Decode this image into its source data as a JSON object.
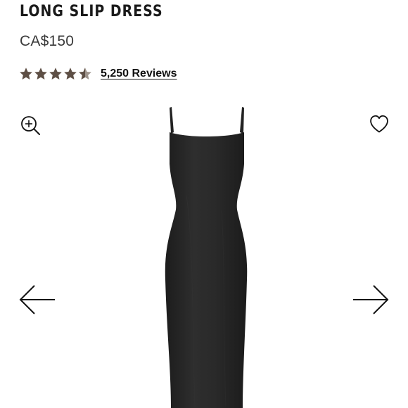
{
  "product": {
    "title": "LONG SLIP DRESS",
    "price": "CA$150",
    "rating": 4.5,
    "rating_max": 5,
    "reviews_label": "5,250 Reviews"
  },
  "colors": {
    "star": "#5e4f45",
    "text": "#1a1a1a",
    "dress": "#262626"
  },
  "icons": {
    "zoom": "zoom-in-icon",
    "wishlist": "heart-icon",
    "prev": "arrow-left-icon",
    "next": "arrow-right-icon"
  }
}
